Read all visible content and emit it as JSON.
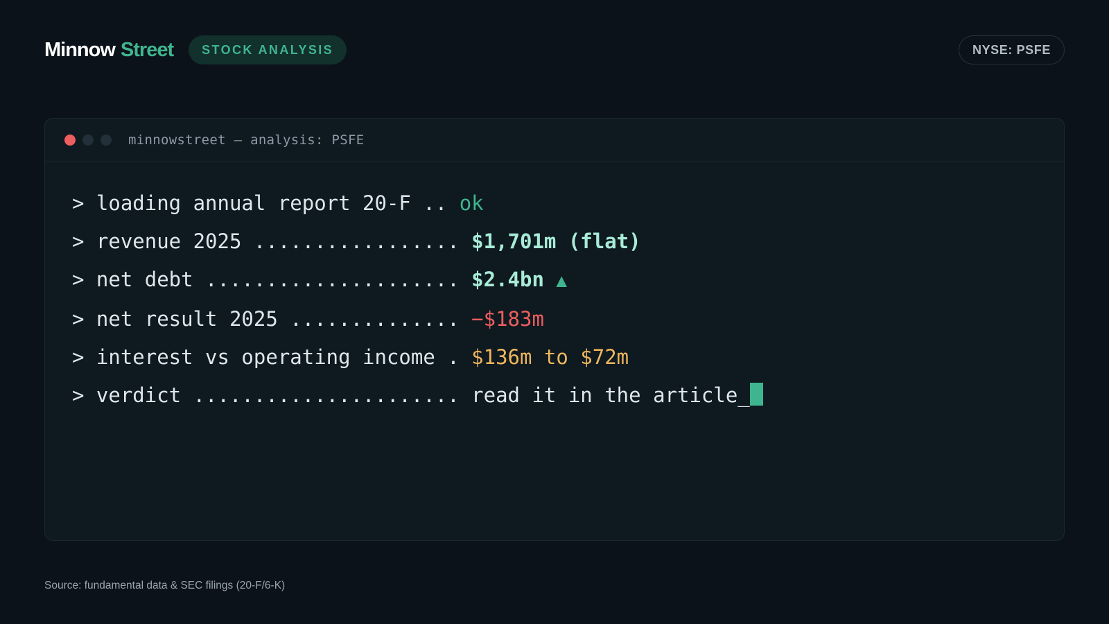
{
  "header": {
    "brand_part1": "Minnow",
    "brand_part2": "Street",
    "section_tag": "STOCK ANALYSIS",
    "ticker": "NYSE: PSFE"
  },
  "terminal": {
    "title": "minnowstreet — analysis: PSFE",
    "lines": [
      {
        "prompt": "> ",
        "label": "loading annual report 20-F .. ",
        "value": "ok"
      },
      {
        "prompt": "> ",
        "label": "revenue 2025 ................. ",
        "value": "$1,701m (flat)"
      },
      {
        "prompt": "> ",
        "label": "net debt ..................... ",
        "value": "$2.4bn",
        "trend_icon": "▲"
      },
      {
        "prompt": "> ",
        "label": "net result 2025 .............. ",
        "value": "−$183m"
      },
      {
        "prompt": "> ",
        "label": "interest vs operating income . ",
        "value": "$136m to $72m"
      },
      {
        "prompt": "> ",
        "label": "verdict ...................... ",
        "value": "read it in the article_"
      }
    ]
  },
  "footer": {
    "source": "Source: fundamental data & SEC filings (20-F/6-K)"
  },
  "colors": {
    "background": "#0b1219",
    "accent": "#3fb58f",
    "highlight": "#a8ebd6",
    "negative": "#ee5e5e",
    "warning": "#f1b65d"
  }
}
